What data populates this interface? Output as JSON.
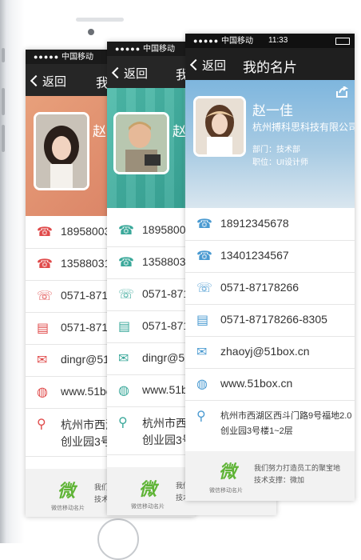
{
  "status": {
    "carrier": "中国移动",
    "time": "11:33"
  },
  "nav": {
    "back_label": "返回",
    "title": "我的名片"
  },
  "back_card": {
    "title_fragment": "我",
    "name_fragment": "赵",
    "rows": [
      "18958003",
      "13588031",
      "0571-8717",
      "0571-8717",
      "dingr@51bo",
      "www.51box",
      "杭州市西湖",
      "创业园3号楼"
    ],
    "theme_color": "#e8a07b",
    "footer_lines": [
      "我们",
      "技术"
    ]
  },
  "mid_card": {
    "title_fragment": "我",
    "name_fragment": "赵",
    "rows": [
      "1895800",
      "1358803",
      "0571-8717",
      "0571-8717",
      "dingr@51b",
      "www.51box",
      "杭州市西湖",
      "创业园3号楼"
    ],
    "theme_color": "#3aa89a",
    "footer_lines": [
      "我们",
      "技术"
    ]
  },
  "front_card": {
    "name": "赵一佳",
    "company": "杭州搏科思科技有限公司",
    "department": "部门：技术部",
    "position": "职位：UI设计师",
    "phone1": "18912345678",
    "phone2": "13401234567",
    "tel": "0571-87178266",
    "fax": "0571-87178266-8305",
    "email": "zhaoyj@51box.cn",
    "website": "www.51box.cn",
    "address_line1": "杭州市西湖区西斗门路9号福地2.0",
    "address_line2": "创业园3号楼1~2层",
    "footer_text_line1": "我们努力打造员工的聚宝地",
    "footer_text_line2": "技术支撑：微加",
    "logo_text": "微",
    "logo_sub": "微信移动名片",
    "theme_color": "#5fa6d8"
  },
  "icons": [
    "phone-icon",
    "mobile-icon",
    "telephone-icon",
    "fax-icon",
    "email-icon",
    "globe-icon",
    "location-icon",
    "share-icon",
    "back-chevron-icon"
  ],
  "colors": {
    "accent_red": "#e04b4b",
    "logo_green": "#5fb436",
    "navbar": "#262626"
  }
}
